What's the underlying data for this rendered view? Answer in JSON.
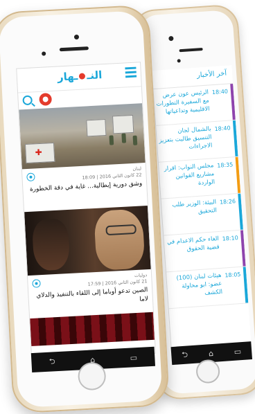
{
  "back_screen": {
    "title": "آخر الأخبار",
    "items": [
      {
        "time": "18:40",
        "text": "الرئيس عون عرض مع السفيرة التطورات الاقليمية وتداعياتها",
        "color": "#8e44ad"
      },
      {
        "time": "18:40",
        "text": "بالشمال لجان التنسيق طالبت بتعزيز الاجراءات",
        "color": "#1aa7d9"
      },
      {
        "time": "18:35",
        "text": "مجلس النواب: اقرار مشاريع القوانين الواردة",
        "color": "#f39c12"
      },
      {
        "time": "18:26",
        "text": "البيئة: الوزير طلب التحقيق",
        "color": "#1aa7d9"
      },
      {
        "time": "18:10",
        "text": "الغاء حكم الاعدام في قضية الحقوق",
        "color": "#8e44ad"
      },
      {
        "time": "18:05",
        "text": "هيئات لبنان (100) عضو: ابو محاولة الكشف",
        "color": "#1aa7d9"
      }
    ]
  },
  "front_screen": {
    "logo_left": "النـ",
    "logo_right": "ـهار",
    "cards": [
      {
        "section": "لبنان",
        "date": "22 كانون الثاني 2016 | 18:09",
        "headline": "وشق دورية إيطالية... غاية في دقة الخطورة"
      },
      {
        "section": "دوليات",
        "date": "21 كانون الثاني 2016 | 17:59",
        "headline": "الصين تدعو أوباما إلى اللقاء بالتنفيذ والدلاي لاما"
      }
    ]
  },
  "nav": {
    "back": "⮌",
    "home": "⌂",
    "recent": "▭"
  },
  "colors": {
    "accent": "#1aa7d9",
    "brand_red": "#e43b2c"
  }
}
